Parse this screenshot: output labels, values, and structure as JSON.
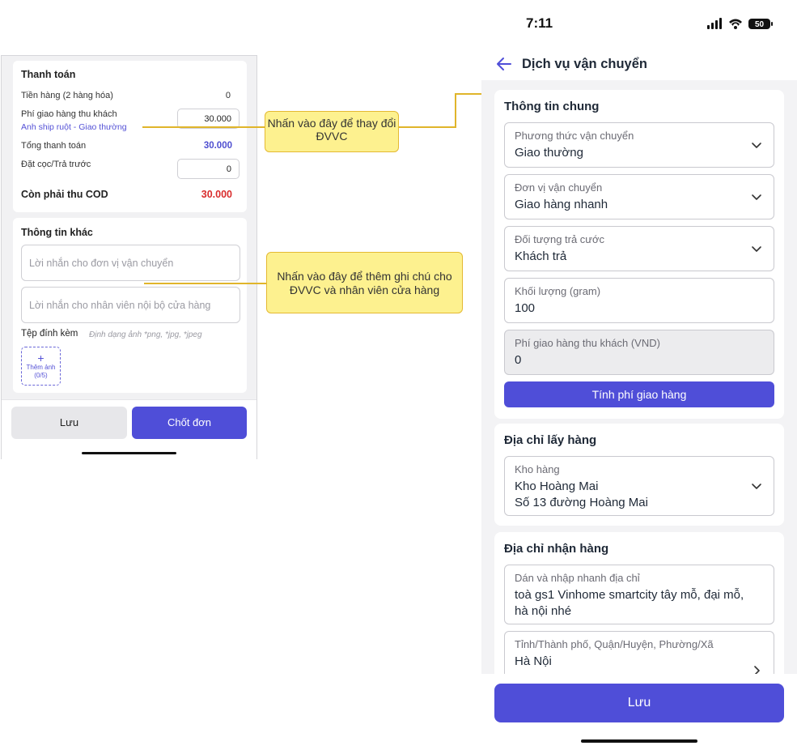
{
  "left": {
    "payment": {
      "title": "Thanh toán",
      "goods_label": "Tiền hàng (2 hàng hóa)",
      "goods_value": "0",
      "shipping_fee_label": "Phí giao hàng thu khách",
      "shipping_link": "Anh ship ruột - Giao thường",
      "shipping_fee_value": "30.000",
      "total_label": "Tổng thanh toán",
      "total_value": "30.000",
      "deposit_label": "Đặt cọc/Trả trước",
      "deposit_value": "0",
      "cod_label": "Còn phải thu COD",
      "cod_value": "30.000"
    },
    "other": {
      "title": "Thông tin khác",
      "carrier_note_placeholder": "Lời nhắn cho đơn vị vận chuyển",
      "staff_note_placeholder": "Lời nhắn cho nhân viên nội bộ cửa hàng",
      "attach_label": "Tệp đính kèm",
      "attach_hint": "Định dạng ảnh *png, *jpg, *jpeg",
      "add_photo_label": "Thêm ảnh",
      "add_photo_count": "(0/5)"
    },
    "buttons": {
      "save": "Lưu",
      "confirm": "Chốt đơn"
    }
  },
  "callouts": {
    "change_carrier": "Nhấn vào đây để thay đổi ĐVVC",
    "add_note": "Nhấn vào đây để thêm ghi chú cho ĐVVC và nhân viên cửa hàng"
  },
  "right": {
    "status_time": "7:11",
    "battery": "50",
    "header_title": "Dịch vụ vận chuyển",
    "general": {
      "title": "Thông tin chung",
      "method_label": "Phương thức vận chuyển",
      "method_value": "Giao thường",
      "carrier_label": "Đơn vị vận chuyển",
      "carrier_value": "Giao hàng nhanh",
      "payer_label": "Đối tượng trả cước",
      "payer_value": "Khách trả",
      "weight_label": "Khối lượng (gram)",
      "weight_value": "100",
      "fee_label": "Phí giao hàng thu khách (VND)",
      "fee_value": "0",
      "calc_button": "Tính phí giao hàng"
    },
    "pickup": {
      "title": "Địa chỉ lấy hàng",
      "warehouse_label": "Kho hàng",
      "warehouse_name": "Kho Hoàng Mai",
      "warehouse_address": "Số 13 đường Hoàng Mai"
    },
    "delivery": {
      "title": "Địa chỉ nhận hàng",
      "paste_label": "Dán và nhập nhanh địa chỉ",
      "paste_line1": "toà gs1 Vinhome smartcity tây mỗ, đại mỗ,",
      "paste_line2": "hà nội nhé",
      "region_label": "Tỉnh/Thành phố, Quận/Huyện, Phường/Xã",
      "region_value": "Hà Nội"
    },
    "save_button": "Lưu"
  }
}
